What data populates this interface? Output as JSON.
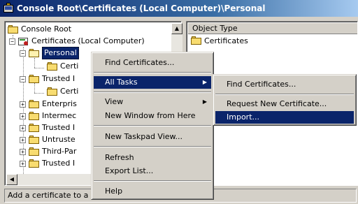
{
  "window": {
    "title": "Console Root\\Certificates (Local Computer)\\Personal"
  },
  "tree": {
    "items": [
      {
        "label": "Console Root"
      },
      {
        "label": "Certificates (Local Computer)"
      },
      {
        "label": "Personal"
      },
      {
        "label": "Certi"
      },
      {
        "label": "Trusted I"
      },
      {
        "label": "Certi"
      },
      {
        "label": "Enterpris"
      },
      {
        "label": "Intermec"
      },
      {
        "label": "Trusted I"
      },
      {
        "label": "Untruste"
      },
      {
        "label": "Third-Par"
      },
      {
        "label": "Trusted I"
      }
    ]
  },
  "right_pane": {
    "column_header": "Object Type",
    "rows": [
      {
        "label": "Certificates"
      }
    ]
  },
  "status": {
    "text": "Add a certificate to a"
  },
  "context_menu": {
    "find": "Find Certificates...",
    "all_tasks": "All Tasks",
    "view": "View",
    "new_window": "New Window from Here",
    "new_taskpad": "New Taskpad View...",
    "refresh": "Refresh",
    "export": "Export List...",
    "help": "Help"
  },
  "submenu": {
    "find": "Find Certificates...",
    "request": "Request New Certificate...",
    "import": "Import..."
  }
}
